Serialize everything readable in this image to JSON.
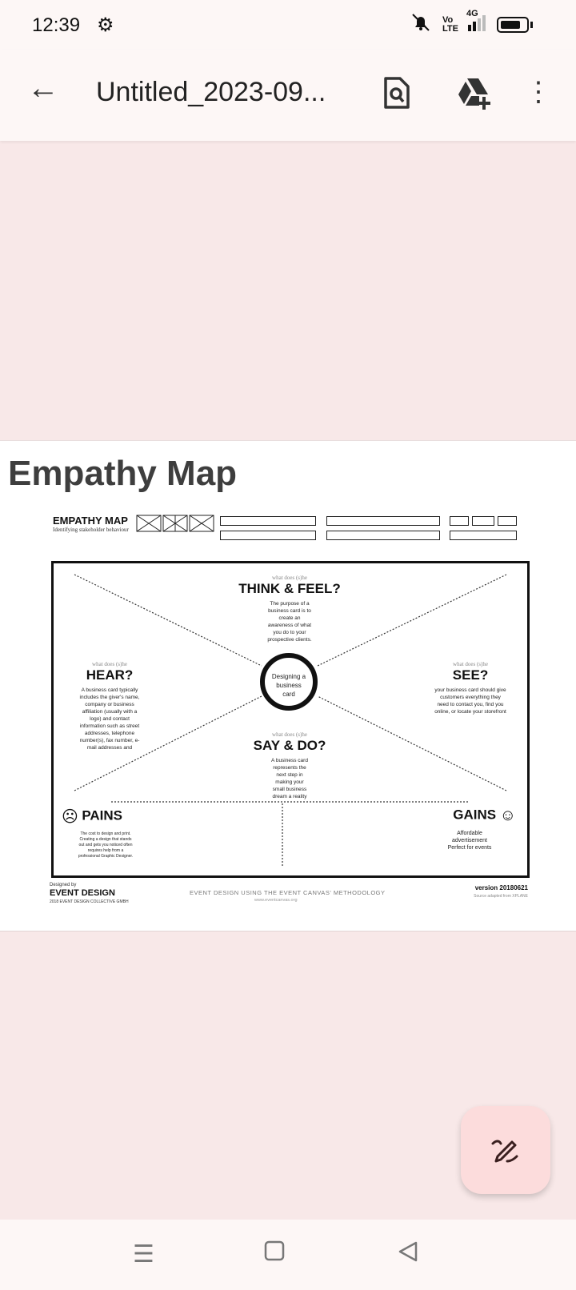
{
  "status_bar": {
    "time": "12:39",
    "network": "4G",
    "volte": "Vo LTE"
  },
  "app_bar": {
    "title": "Untitled_2023-09..."
  },
  "document": {
    "heading": "Empathy Map",
    "map": {
      "title": "EMPATHY MAP",
      "subtitle": "Identifying stakeholder behaviour",
      "center": "Designing a business card",
      "think_feel": {
        "prefix": "what does (s)he",
        "label": "THINK & FEEL?",
        "body": "The purpose of a business card is to create an awareness of what you do to your prospective clients."
      },
      "hear": {
        "prefix": "what does (s)he",
        "label": "HEAR?",
        "body": "A business card typically includes the giver's name, company or business affiliation (usually with a logo) and contact information such as street addresses, telephone number(s), fax number, e-mail addresses and"
      },
      "see": {
        "prefix": "what does (s)he",
        "label": "SEE?",
        "body": "your business card should give customers everything they need to contact you, find you online, or locate your storefront"
      },
      "say_do": {
        "prefix": "what does (s)he",
        "label": "SAY & DO?",
        "body": "A business card represents the next step in making your small business dream a reality"
      },
      "pains": {
        "label": "PAINS",
        "body": "The cost to design and print. Creating a design that stands out and gets you noticed often requires help from a professional Graphic Designer."
      },
      "gains": {
        "label": "GAINS",
        "body": "Affordable advertisement Perfect for events"
      },
      "footer": {
        "designed_by": "Designed by",
        "brand": "EVENT DESIGN",
        "copyright": "2018 EVENT DESIGN COLLECTIVE GMBH",
        "methodology": "EVENT DESIGN USING THE EVENT CANVAS' METHODOLOGY",
        "url": "www.eventcanvas.org",
        "version": "version 20180621",
        "source": "Source adapted from XPLANE"
      }
    }
  },
  "fab": {
    "icon": "edit-pen-icon"
  }
}
